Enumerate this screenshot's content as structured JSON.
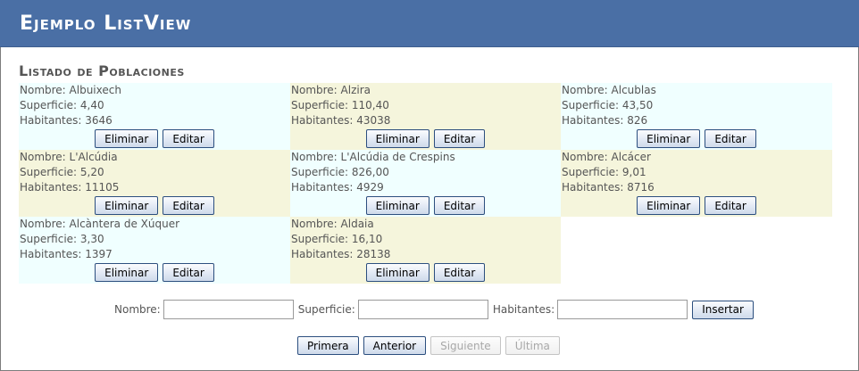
{
  "app": {
    "title": "Ejemplo ListView"
  },
  "list": {
    "title": "Listado de Poblaciones",
    "items": [
      {
        "nombre": "Nombre: Albuixech",
        "superficie": "Superficie: 4,40",
        "habitantes": "Habitantes: 3646"
      },
      {
        "nombre": "Nombre: Alzira",
        "superficie": "Superficie: 110,40",
        "habitantes": "Habitantes: 43038"
      },
      {
        "nombre": "Nombre: Alcublas",
        "superficie": "Superficie: 43,50",
        "habitantes": "Habitantes: 826"
      },
      {
        "nombre": "Nombre: L'Alcúdia",
        "superficie": "Superficie: 5,20",
        "habitantes": "Habitantes: 11105"
      },
      {
        "nombre": "Nombre: L'Alcúdia de Crespins",
        "superficie": "Superficie: 826,00",
        "habitantes": "Habitantes: 4929"
      },
      {
        "nombre": "Nombre: Alcácer",
        "superficie": "Superficie: 9,01",
        "habitantes": "Habitantes: 8716"
      },
      {
        "nombre": "Nombre: Alcàntera de Xúquer",
        "superficie": "Superficie: 3,30",
        "habitantes": "Habitantes: 1397"
      },
      {
        "nombre": "Nombre: Aldaia",
        "superficie": "Superficie: 16,10",
        "habitantes": "Habitantes: 28138"
      }
    ],
    "delete_label": "Eliminar",
    "edit_label": "Editar"
  },
  "insert": {
    "nombre_label": "Nombre:",
    "nombre_value": "",
    "superficie_label": "Superficie:",
    "superficie_value": "",
    "habitantes_label": "Habitantes:",
    "habitantes_value": "",
    "submit_label": "Insertar"
  },
  "pager": {
    "first": "Primera",
    "previous": "Anterior",
    "next": "Siguiente",
    "last": "Última"
  },
  "colors": {
    "header": "#4a6fa5",
    "row_a": "#f0ffff",
    "row_b": "#f5f5dc"
  }
}
